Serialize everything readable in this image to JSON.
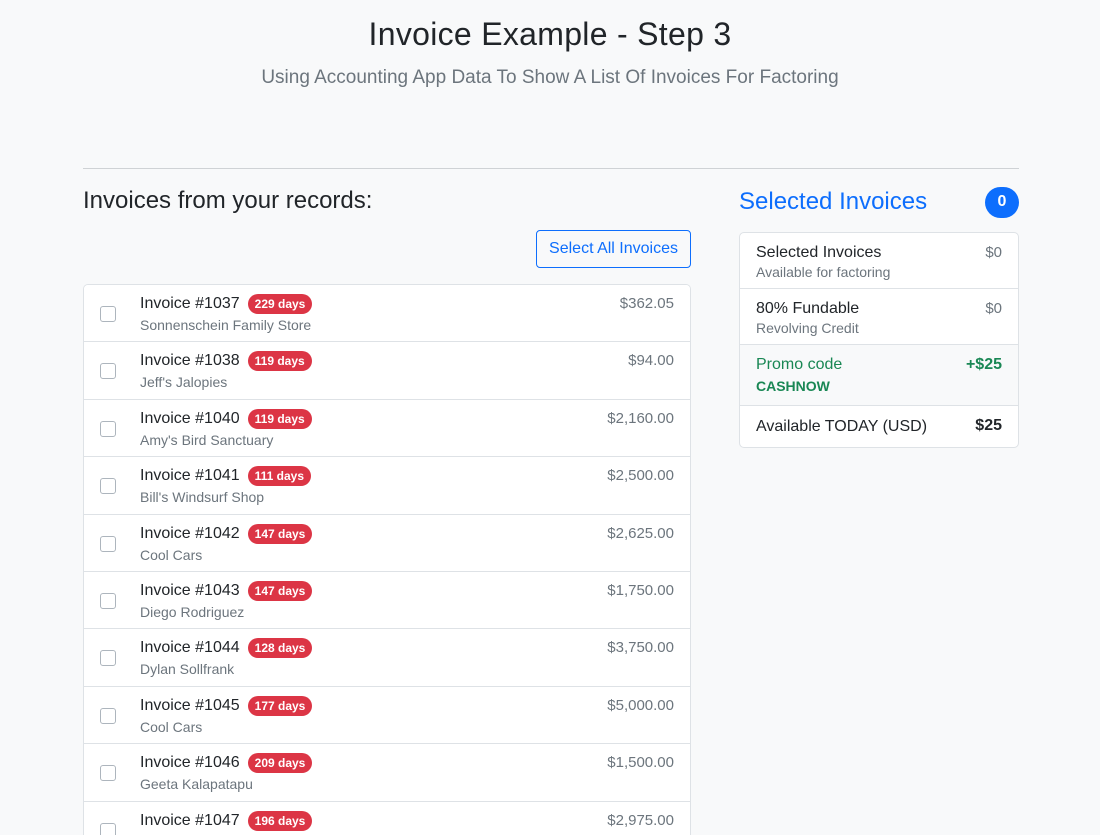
{
  "header": {
    "title": "Invoice Example - Step 3",
    "subtitle": "Using Accounting App Data To Show A List Of Invoices For Factoring"
  },
  "invoices_section": {
    "title": "Invoices from your records:",
    "select_all_label": "Select All Invoices",
    "rows": [
      {
        "number": "Invoice #1037",
        "days": "229 days",
        "customer": "Sonnenschein Family Store",
        "amount": "$362.05"
      },
      {
        "number": "Invoice #1038",
        "days": "119 days",
        "customer": "Jeff's Jalopies",
        "amount": "$94.00"
      },
      {
        "number": "Invoice #1040",
        "days": "119 days",
        "customer": "Amy's Bird Sanctuary",
        "amount": "$2,160.00"
      },
      {
        "number": "Invoice #1041",
        "days": "111 days",
        "customer": "Bill's Windsurf Shop",
        "amount": "$2,500.00"
      },
      {
        "number": "Invoice #1042",
        "days": "147 days",
        "customer": "Cool Cars",
        "amount": "$2,625.00"
      },
      {
        "number": "Invoice #1043",
        "days": "147 days",
        "customer": "Diego Rodriguez",
        "amount": "$1,750.00"
      },
      {
        "number": "Invoice #1044",
        "days": "128 days",
        "customer": "Dylan Sollfrank",
        "amount": "$3,750.00"
      },
      {
        "number": "Invoice #1045",
        "days": "177 days",
        "customer": "Cool Cars",
        "amount": "$5,000.00"
      },
      {
        "number": "Invoice #1046",
        "days": "209 days",
        "customer": "Geeta Kalapatapu",
        "amount": "$1,500.00"
      },
      {
        "number": "Invoice #1047",
        "days": "196 days",
        "customer": "",
        "amount": "$2,975.00"
      }
    ]
  },
  "selected_panel": {
    "title": "Selected Invoices",
    "count": "0",
    "rows": {
      "selected": {
        "label": "Selected Invoices",
        "sub": "Available for factoring",
        "value": "$0"
      },
      "fundable": {
        "label": "80% Fundable",
        "sub": "Revolving Credit",
        "value": "$0"
      },
      "promo": {
        "label": "Promo code",
        "code": "CASHNOW",
        "value": "+$25"
      },
      "total": {
        "label": "Available TODAY (USD)",
        "value": "$25"
      }
    }
  },
  "colors": {
    "primary": "#0d6efd",
    "danger": "#dc3545",
    "success": "#198754"
  }
}
